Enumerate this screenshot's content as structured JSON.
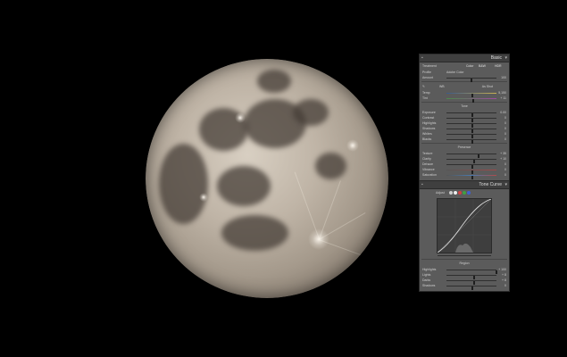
{
  "photo": {
    "subject": "moon"
  },
  "basic_panel": {
    "title": "Basic",
    "treatment_label": "Treatment",
    "treatment_options": [
      "Color",
      "B&W",
      "HDR"
    ],
    "profile_label": "Profile",
    "profile_value": "Adobe Color",
    "amount_label": "Amount",
    "amount_value": "100",
    "wb_label": "WB",
    "wb_value": "As Shot",
    "temp_label": "Temp",
    "temp_value": "5,150",
    "tint_label": "Tint",
    "tint_value": "+ 11",
    "tone_header": "Tone",
    "tone_rows": [
      {
        "label": "Exposure",
        "value": "0.00"
      },
      {
        "label": "Contrast",
        "value": "0"
      },
      {
        "label": "Highlights",
        "value": "0"
      },
      {
        "label": "Shadows",
        "value": "0"
      },
      {
        "label": "Whites",
        "value": "0"
      },
      {
        "label": "Blacks",
        "value": "0"
      }
    ],
    "presence_header": "Presence",
    "presence_rows": [
      {
        "label": "Texture",
        "value": "+ 35"
      },
      {
        "label": "Clarity",
        "value": "+ 10"
      },
      {
        "label": "Dehaze",
        "value": "0"
      },
      {
        "label": "Vibrance",
        "value": "0"
      },
      {
        "label": "Saturation",
        "value": "0"
      }
    ]
  },
  "tone_curve_panel": {
    "title": "Tone Curve",
    "adjust_label": "Adjust",
    "region_header": "Region",
    "region_rows": [
      {
        "label": "Highlights",
        "value": "+ 100"
      },
      {
        "label": "Lights",
        "value": "+ 8"
      },
      {
        "label": "Darks",
        "value": "+ 8"
      },
      {
        "label": "Shadows",
        "value": "0"
      }
    ]
  }
}
